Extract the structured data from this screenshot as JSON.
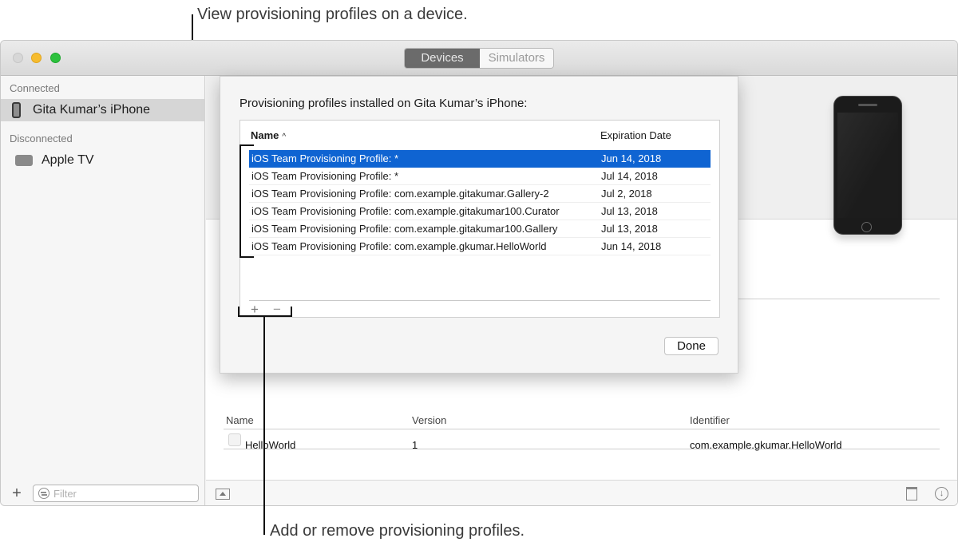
{
  "annotations": {
    "top": "View provisioning profiles on a device.",
    "bottom": "Add or remove provisioning profiles."
  },
  "window": {
    "segmented": {
      "active": "Devices",
      "inactive": "Simulators"
    }
  },
  "sidebar": {
    "sections": [
      {
        "label": "Connected",
        "items": [
          {
            "label": "Gita Kumar’s iPhone",
            "icon": "iphone-icon",
            "selected": true
          }
        ]
      },
      {
        "label": "Disconnected",
        "items": [
          {
            "label": "Apple TV",
            "icon": "apple-tv-icon",
            "selected": false
          }
        ]
      }
    ],
    "add_label": "+",
    "filter_placeholder": "Filter"
  },
  "apps_table": {
    "columns": [
      "Name",
      "Version",
      "Identifier"
    ],
    "rows": [
      {
        "name": "HelloWorld",
        "version": "1",
        "identifier": "com.example.gkumar.HelloWorld"
      }
    ],
    "tools": {
      "add": "+",
      "remove": "−",
      "separator": "|"
    }
  },
  "sheet": {
    "title": "Provisioning profiles installed on Gita Kumar’s iPhone:",
    "columns": {
      "name": "Name",
      "name_sort": "^",
      "date": "Expiration Date"
    },
    "rows": [
      {
        "name": "iOS Team Provisioning Profile: *",
        "date": "Jun 14, 2018",
        "selected": true
      },
      {
        "name": "iOS Team Provisioning Profile: *",
        "date": "Jul 14, 2018",
        "selected": false
      },
      {
        "name": "iOS Team Provisioning Profile: com.example.gitakumar.Gallery-2",
        "date": "Jul 2, 2018",
        "selected": false
      },
      {
        "name": "iOS Team Provisioning Profile: com.example.gitakumar100.Curator",
        "date": "Jul 13, 2018",
        "selected": false
      },
      {
        "name": "iOS Team Provisioning Profile: com.example.gitakumar100.Gallery",
        "date": "Jul 13, 2018",
        "selected": false
      },
      {
        "name": "iOS Team Provisioning Profile: com.example.gkumar.HelloWorld",
        "date": "Jun 14, 2018",
        "selected": false
      }
    ],
    "tools": {
      "add": "+",
      "remove": "−"
    },
    "done_label": "Done"
  },
  "colors": {
    "selection": "#0f64d2",
    "segment_active": "#6b6b6b"
  }
}
